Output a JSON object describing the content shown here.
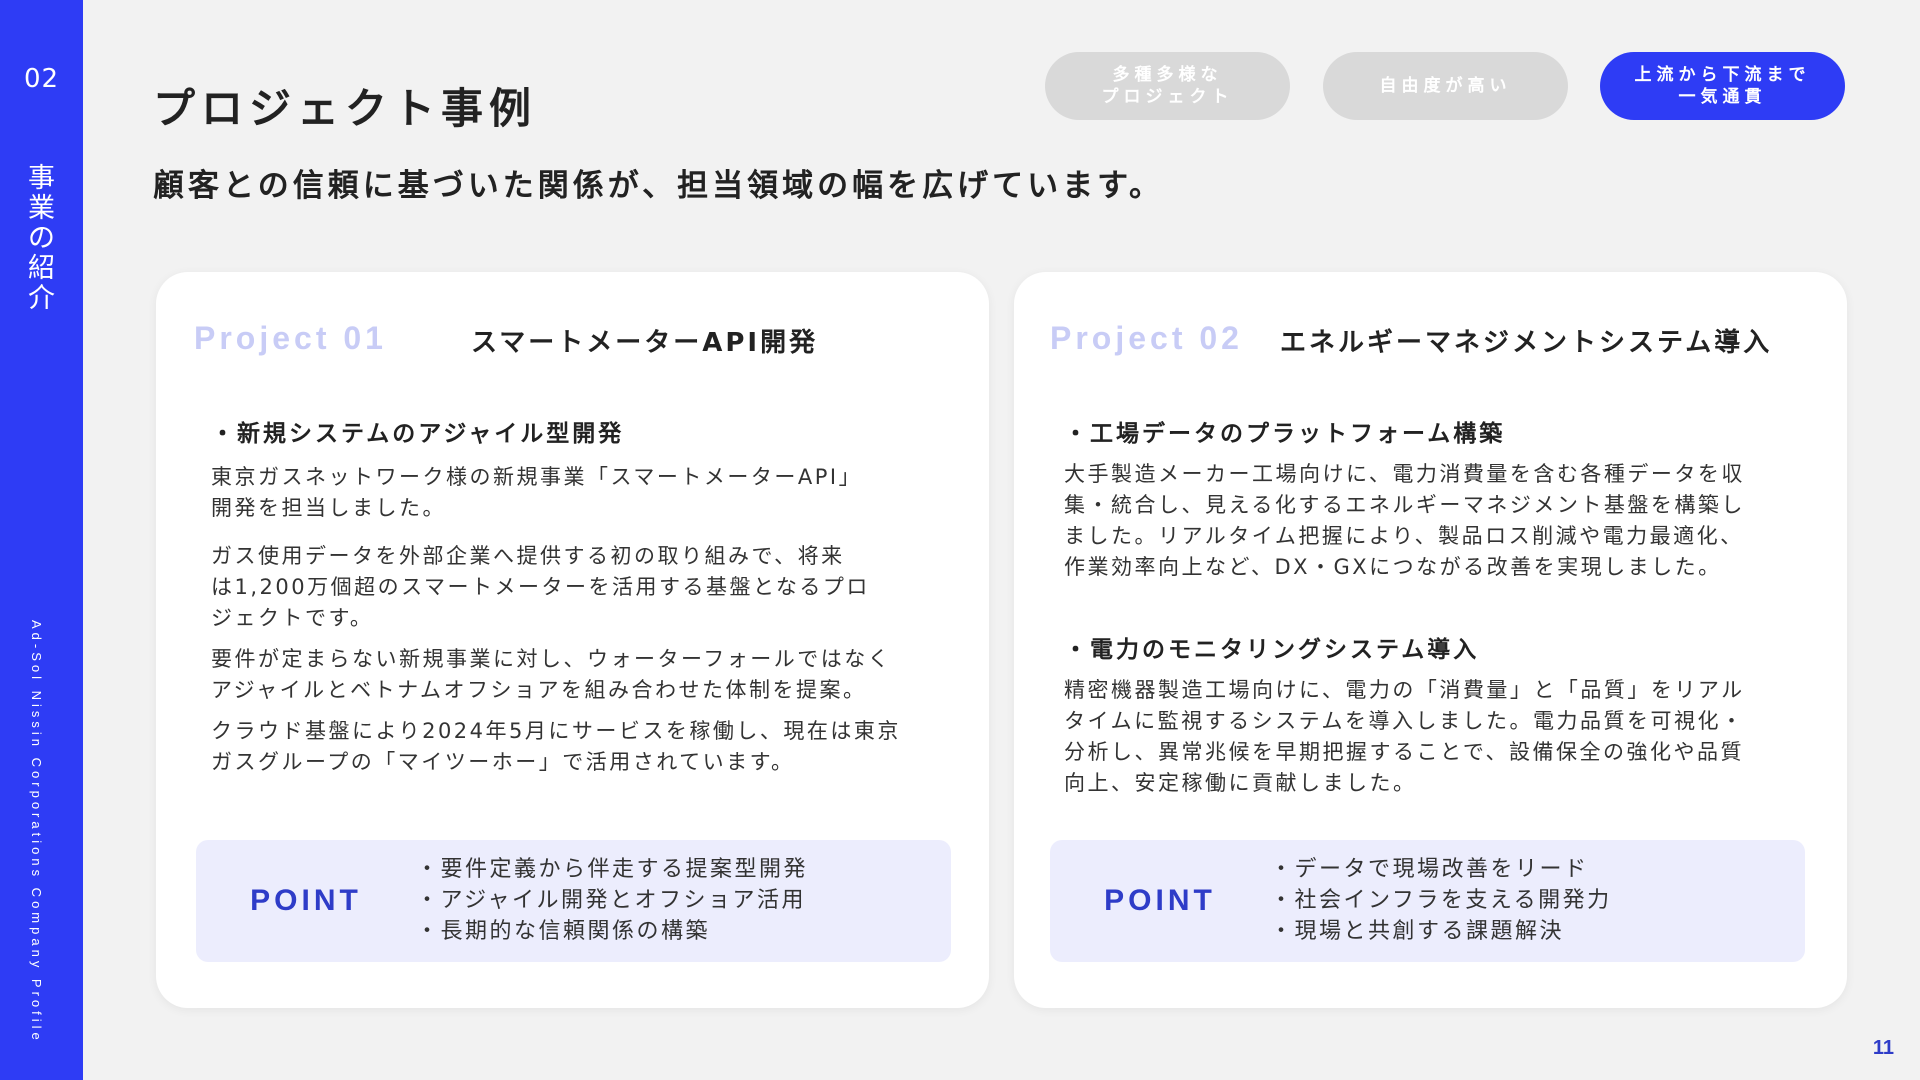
{
  "sidebar": {
    "section_number": "02",
    "section_title_chars": [
      "事",
      "業",
      "の",
      "紹",
      "介"
    ],
    "company": "Ad-Sol Nissin Corporations Company Profile"
  },
  "header": {
    "title": "プロジェクト事例",
    "subtitle": "顧客との信頼に基づいた関係が、担当領域の幅を広げています。",
    "tags": [
      {
        "line1": "多種多様な",
        "line2": "プロジェクト",
        "active": false
      },
      {
        "line1": "自由度が高い",
        "line2": "",
        "active": false
      },
      {
        "line1": "上流から下流まで",
        "line2": "一気通貫",
        "active": true
      }
    ]
  },
  "projects": [
    {
      "label": "Project 01",
      "title": "スマートメーターAPI開発",
      "sections": [
        {
          "heading": "・新規システムのアジャイル型開発",
          "paragraphs": [
            [
              "東京ガスネットワーク様の新規事業「スマートメーターAPI」",
              "開発を担当しました。"
            ],
            [
              "ガス使用データを外部企業へ提供する初の取り組みで、将来",
              "は1,200万個超のスマートメーターを活用する基盤となるプロ",
              "ジェクトです。"
            ],
            [
              "要件が定まらない新規事業に対し、ウォーターフォールではなく",
              "アジャイルとベトナムオフショアを組み合わせた体制を提案。"
            ],
            [
              "クラウド基盤により2024年5月にサービスを稼働し、現在は東京",
              "ガスグループの「マイツーホー」で活用されています。"
            ]
          ]
        }
      ],
      "point_label": "POINT",
      "points": [
        "・要件定義から伴走する提案型開発",
        "・アジャイル開発とオフショア活用",
        "・長期的な信頼関係の構築"
      ]
    },
    {
      "label": "Project 02",
      "title": "エネルギーマネジメントシステム導入",
      "sections": [
        {
          "heading": "・工場データのプラットフォーム構築",
          "paragraphs": [
            [
              "大手製造メーカー工場向けに、電力消費量を含む各種データを収",
              "集・統合し、見える化するエネルギーマネジメント基盤を構築し",
              "ました。リアルタイム把握により、製品ロス削減や電力最適化、",
              "作業効率向上など、DX・GXにつながる改善を実現しました。"
            ]
          ]
        },
        {
          "heading": "・電力のモニタリングシステム導入",
          "paragraphs": [
            [
              "精密機器製造工場向けに、電力の「消費量」と「品質」をリアル",
              "タイムに監視するシステムを導入しました。電力品質を可視化・",
              "分析し、異常兆候を早期把握することで、設備保全の強化や品質",
              "向上、安定稼働に貢献しました。"
            ]
          ]
        }
      ],
      "point_label": "POINT",
      "points": [
        "・データで現場改善をリード",
        "・社会インフラを支える開発力",
        "・現場と共創する課題解決"
      ]
    }
  ],
  "page_number": "11",
  "colors": {
    "accent": "#2e3cf5",
    "tag_inactive": "#d9d9d9",
    "point_bg": "#ecedfd",
    "label_light": "#c8ccf6"
  }
}
